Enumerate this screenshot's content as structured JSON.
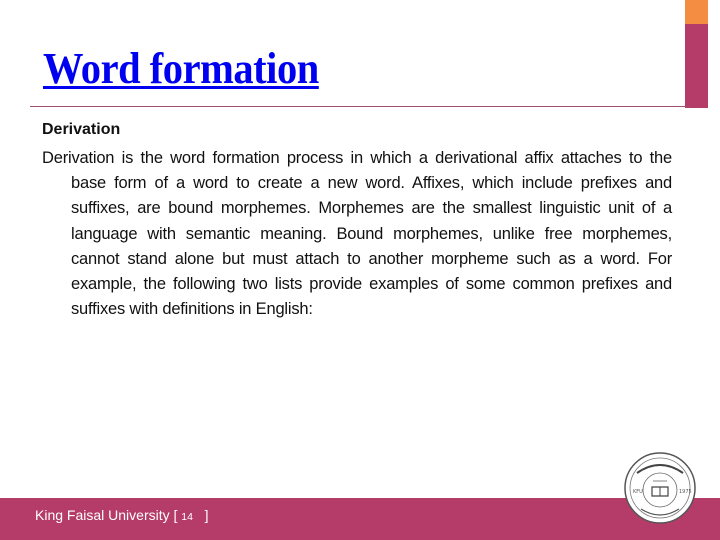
{
  "slide": {
    "title": "Word formation",
    "heading": "Derivation",
    "body": "Derivation is the word formation process in which a derivational affix attaches to the base form of a word to create a new word. Affixes, which include prefixes and suffixes, are bound morphemes. Morphemes are the smallest linguistic unit of a language with semantic meaning. Bound morphemes, unlike free morphemes, cannot stand alone but must attach to another morpheme such as a word. For example, the following two lists provide examples of some common prefixes and suffixes with definitions in English:"
  },
  "footer": {
    "institution": "King Faisal University",
    "open_bracket": " [ ",
    "page_number": "14",
    "close_bracket": "   ]",
    "logo_icon": "university-seal-icon"
  },
  "colors": {
    "title": "#0000f0",
    "accent_orange": "#f48c42",
    "accent_magenta": "#b53b68",
    "footer_bg": "#b53b68"
  }
}
